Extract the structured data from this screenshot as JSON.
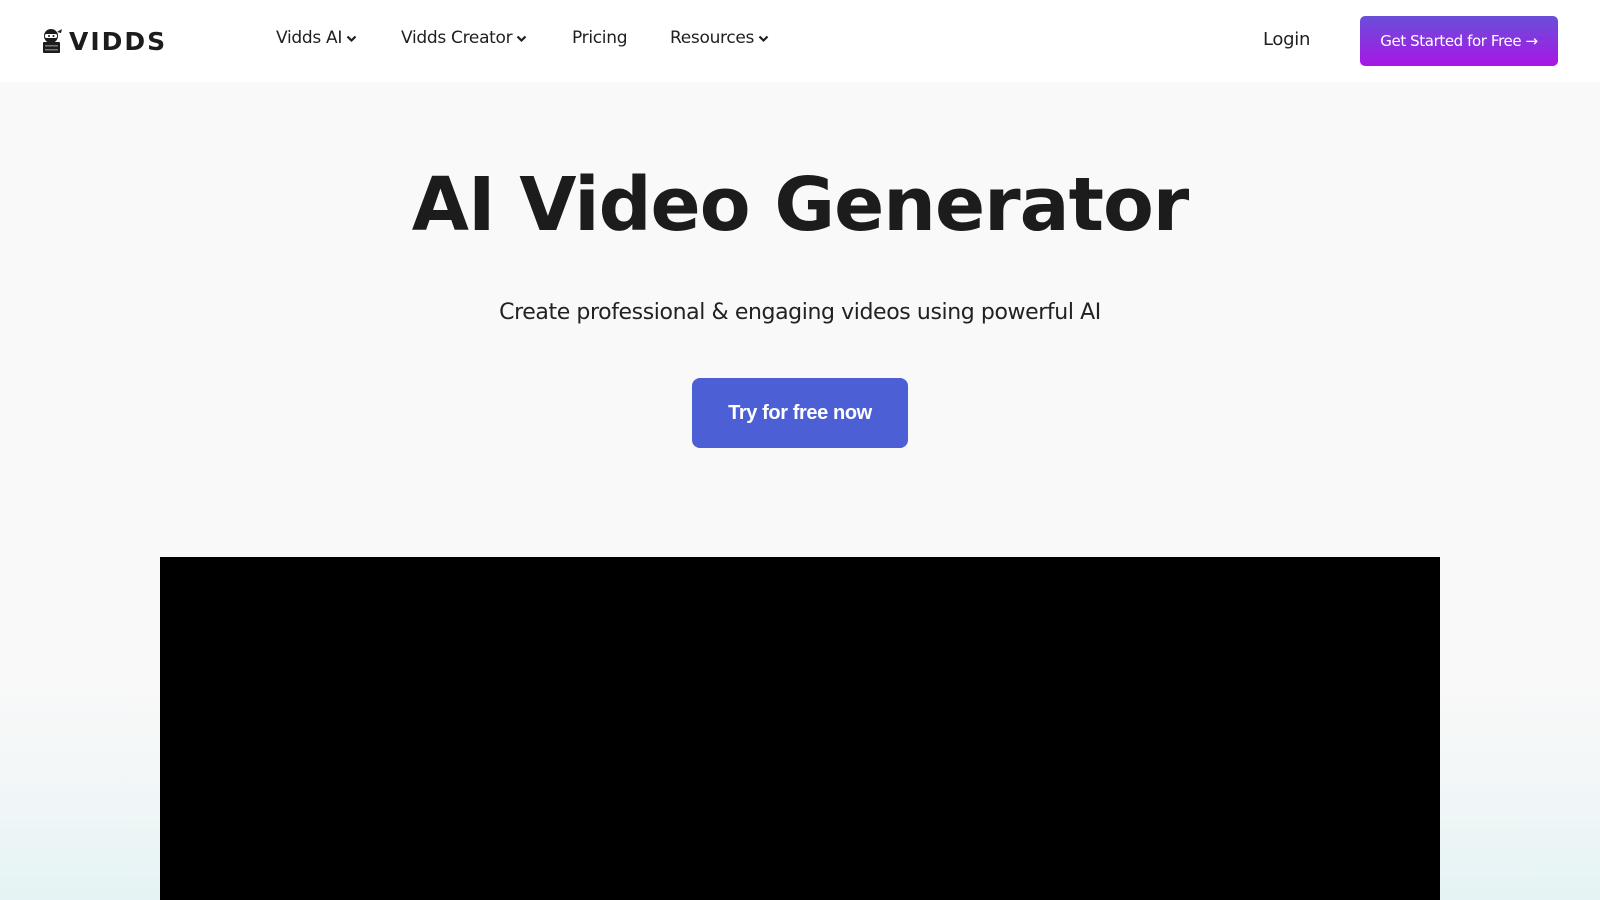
{
  "header": {
    "logo": {
      "icon": "ninja-mascot-icon",
      "text": "VIDDS"
    },
    "nav": [
      {
        "label": "Vidds AI",
        "has_dropdown": true,
        "icon": "chevron-down-icon"
      },
      {
        "label": "Vidds Creator",
        "has_dropdown": true,
        "icon": "chevron-down-icon"
      },
      {
        "label": "Pricing",
        "has_dropdown": false
      },
      {
        "label": "Resources",
        "has_dropdown": true,
        "icon": "chevron-down-icon"
      }
    ],
    "login_label": "Login",
    "cta_label": "Get Started for Free →"
  },
  "hero": {
    "title": "AI Video Generator",
    "subtitle": "Create professional & engaging videos using powerful AI",
    "cta_label": "Try for free now"
  },
  "video": {
    "state": "black frame"
  },
  "colors": {
    "page_bg": "#f9f9f9",
    "header_bg": "#ffffff",
    "text": "#1c1c1c",
    "cta_main": "#4c5fd5",
    "cta_top_gradient_start": "#6a4fd8",
    "cta_top_gradient_end": "#a716e6",
    "bottom_tint": "#e5f3f4",
    "video_bg": "#000000"
  }
}
